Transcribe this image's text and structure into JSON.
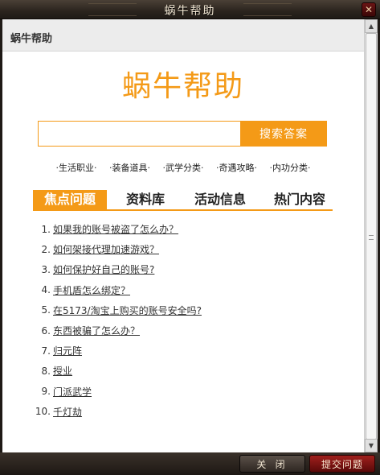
{
  "window": {
    "title": "蜗牛帮助",
    "close_glyph": "✕"
  },
  "header": {
    "label": "蜗牛帮助"
  },
  "main": {
    "big_title": "蜗牛帮助",
    "search": {
      "value": "",
      "placeholder": "",
      "button_label": "搜索答案"
    },
    "categories": [
      "·生活职业·",
      "·装备道具·",
      "·武学分类·",
      "·奇遇攻略·",
      "·内功分类·"
    ],
    "tabs": [
      {
        "label": "焦点问题",
        "active": true
      },
      {
        "label": "资料库",
        "active": false
      },
      {
        "label": "活动信息",
        "active": false
      },
      {
        "label": "热门内容",
        "active": false
      }
    ],
    "questions": [
      {
        "num": "1.",
        "text": "如果我的账号被盗了怎么办？"
      },
      {
        "num": "2.",
        "text": "如何架接代理加速游戏？"
      },
      {
        "num": "3.",
        "text": "如何保护好自己的账号?"
      },
      {
        "num": "4.",
        "text": "手机盾怎么绑定？"
      },
      {
        "num": "5.",
        "text": "在5173/淘宝上购买的账号安全吗?"
      },
      {
        "num": "6.",
        "text": "东西被骗了怎么办？"
      },
      {
        "num": "7.",
        "text": "归元阵"
      },
      {
        "num": "8.",
        "text": "授业"
      },
      {
        "num": "9.",
        "text": "门派武学"
      },
      {
        "num": "10.",
        "text": "千灯劫"
      }
    ]
  },
  "scrollbar": {
    "up_glyph": "▲",
    "down_glyph": "▼"
  },
  "footer": {
    "close_label": "关 闭",
    "submit_label": "提交问题"
  },
  "colors": {
    "accent": "#f49a17",
    "title_bar": "#2b241e",
    "submit_button": "#8a1513"
  }
}
